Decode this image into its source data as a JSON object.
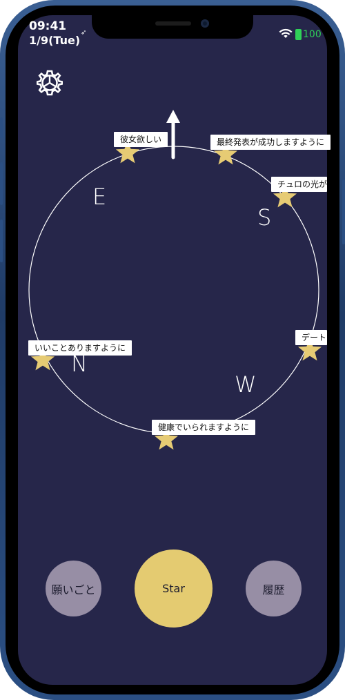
{
  "status_bar": {
    "time": "09:41",
    "date": "1/9(Tue)",
    "battery": "100"
  },
  "compass": {
    "directions": {
      "north": "N",
      "east": "E",
      "south": "S",
      "west": "W"
    },
    "wishes": [
      {
        "label": "彼女欲しい"
      },
      {
        "label": "最終発表が成功しますように"
      },
      {
        "label": "チュロの光が"
      },
      {
        "label": "デート"
      },
      {
        "label": "健康でいられますように"
      },
      {
        "label": "いいことありますように"
      }
    ]
  },
  "buttons": {
    "wish": "願いごと",
    "star": "Star",
    "history": "履歴"
  },
  "colors": {
    "background": "#26264a",
    "star": "#e6cb74",
    "star_button": "#e4cb71",
    "side_button": "#978ea5",
    "battery": "#2fd158"
  }
}
